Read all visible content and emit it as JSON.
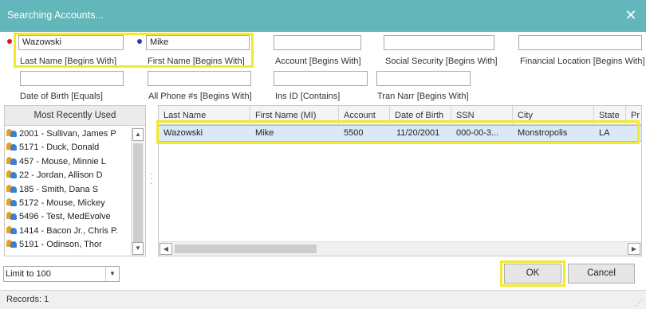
{
  "window": {
    "title": "Searching Accounts..."
  },
  "search_fields": {
    "last_name": {
      "value": "Wazowski",
      "label": "Last Name [Begins With]"
    },
    "first_name": {
      "value": "Mike",
      "label": "First Name [Begins With]"
    },
    "account": {
      "value": "",
      "label": "Account [Begins With]"
    },
    "ssn": {
      "value": "",
      "label": "Social Security [Begins With]"
    },
    "financial_location": {
      "value": "",
      "label": "Financial Location [Begins With]"
    },
    "dob": {
      "value": "",
      "label": "Date of Birth [Equals]"
    },
    "phone": {
      "value": "",
      "label": "All Phone #s [Begins With]"
    },
    "ins_id": {
      "value": "",
      "label": "Ins ID [Contains]"
    },
    "tran_narr": {
      "value": "",
      "label": "Tran Narr [Begins With]"
    }
  },
  "recent": {
    "header": "Most Recently Used",
    "items": [
      "2001 - Sullivan, James P",
      "5171 - Duck, Donald",
      "457 - Mouse, Minnie L",
      "22 - Jordan, Allison D",
      "185 - Smith, Dana S",
      "5172 - Mouse, Mickey",
      "5496 - Test, MedEvolve",
      "1414 - Bacon Jr., Chris P.",
      "5191 - Odinson, Thor"
    ]
  },
  "results": {
    "columns": [
      "Last Name",
      "First Name (MI)",
      "Account",
      "Date of Birth",
      "SSN",
      "City",
      "State",
      "Pr"
    ],
    "rows": [
      [
        "Wazowski",
        "Mike",
        "5500",
        "11/20/2001",
        "000-00-3...",
        "Monstropolis",
        "LA",
        ""
      ]
    ]
  },
  "limit": {
    "value": "Limit to 100"
  },
  "buttons": {
    "ok": "OK",
    "cancel": "Cancel"
  },
  "status": {
    "text": "Records: 1"
  },
  "colors": {
    "titlebar": "#63b6b9",
    "highlight": "#f2e92d",
    "selected_row": "#dbe8f6",
    "required_red": "#e0141e",
    "required_blue": "#1f3fbf"
  }
}
